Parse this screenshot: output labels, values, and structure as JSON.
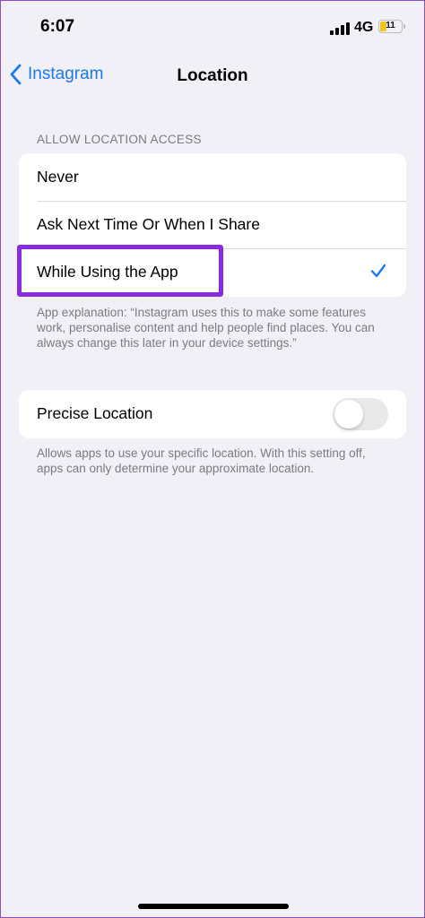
{
  "status_bar": {
    "time": "6:07",
    "network": "4G",
    "battery_level": "11",
    "battery_color": "#f3c419"
  },
  "nav": {
    "back_label": "Instagram",
    "title": "Location",
    "back_icon": "chevron-left-icon"
  },
  "location_access": {
    "header": "ALLOW LOCATION ACCESS",
    "options": [
      {
        "label": "Never",
        "selected": false
      },
      {
        "label": "Ask Next Time Or When I Share",
        "selected": false
      },
      {
        "label": "While Using the App",
        "selected": true
      }
    ],
    "selected_icon": "checkmark-icon",
    "explanation": "App explanation: “Instagram uses this to make some features work, personalise content and help people find places. You can always change this later in your device settings.”"
  },
  "precise_location": {
    "label": "Precise Location",
    "enabled": false,
    "footnote": "Allows apps to use your specific location. With this setting off, apps can only determine your approximate location."
  },
  "colors": {
    "accent": "#1a78f2",
    "highlight": "#8a2be2",
    "background": "#f1f0f6"
  }
}
